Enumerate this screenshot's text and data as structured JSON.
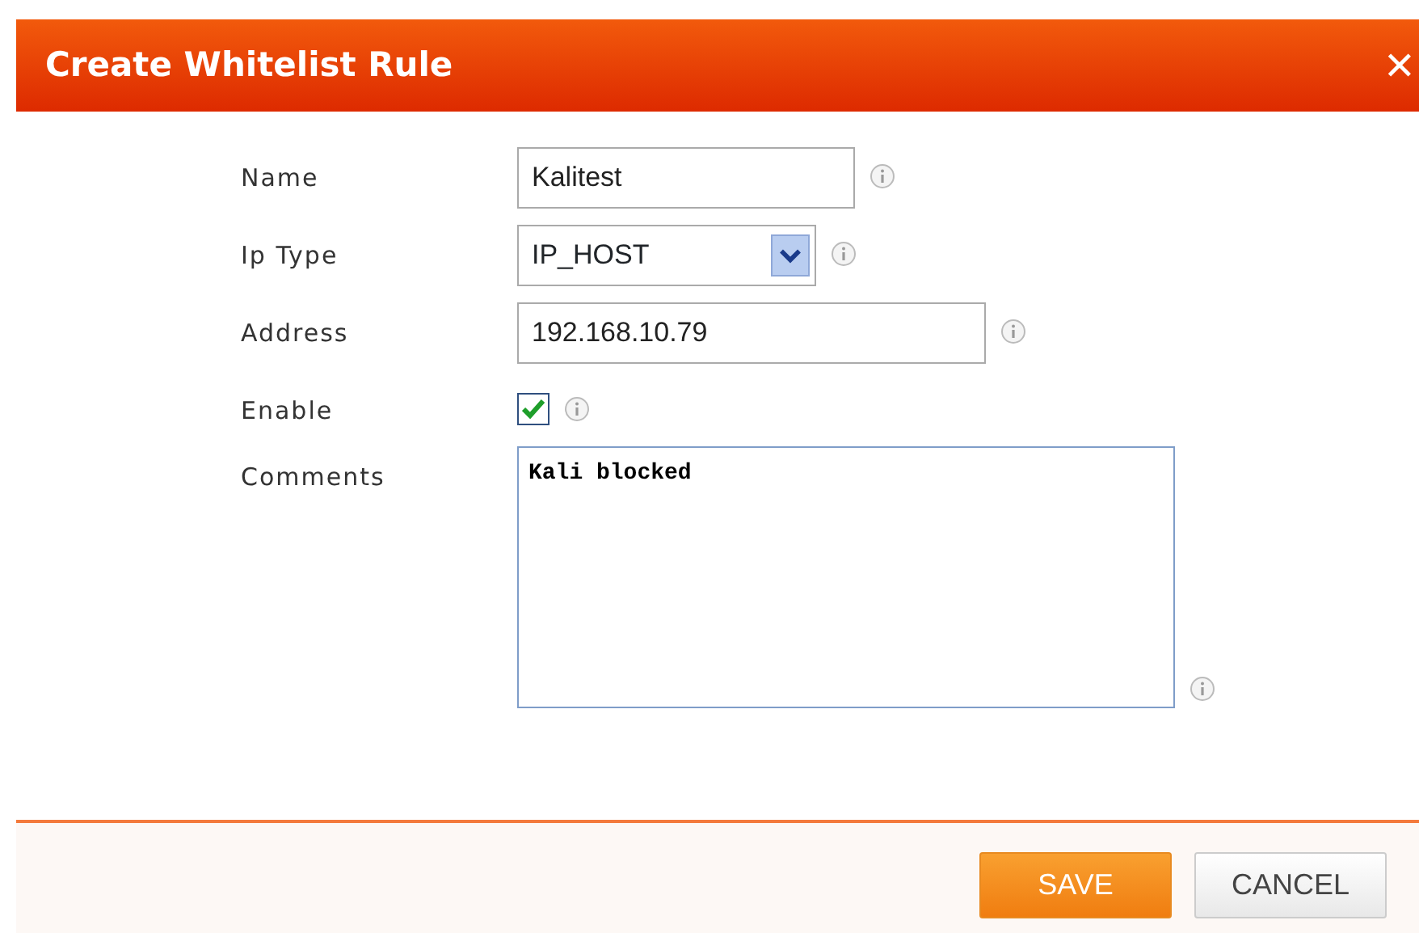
{
  "dialog": {
    "title": "Create Whitelist Rule",
    "close": "✕"
  },
  "fields": [
    {
      "kind": "text",
      "label": "Name",
      "value": "Kalitest"
    },
    {
      "kind": "select",
      "label": "Ip Type",
      "value": "IP_HOST"
    },
    {
      "kind": "text",
      "label": "Address",
      "value": "192.168.10.79",
      "wide": true
    },
    {
      "kind": "checkbox",
      "label": "Enable",
      "checked": true
    },
    {
      "kind": "textarea",
      "label": "Comments",
      "value": "Kali blocked"
    }
  ],
  "buttons": [
    {
      "kind": "primary",
      "label": "SAVE"
    },
    {
      "kind": "secondary",
      "label": "CANCEL"
    }
  ]
}
